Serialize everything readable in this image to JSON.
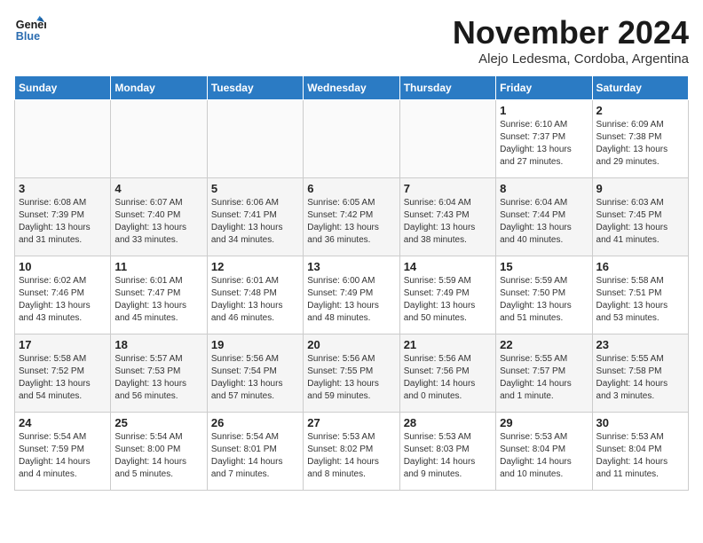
{
  "logo": {
    "line1": "General",
    "line2": "Blue"
  },
  "title": "November 2024",
  "subtitle": "Alejo Ledesma, Cordoba, Argentina",
  "days_of_week": [
    "Sunday",
    "Monday",
    "Tuesday",
    "Wednesday",
    "Thursday",
    "Friday",
    "Saturday"
  ],
  "weeks": [
    [
      {
        "day": "",
        "info": ""
      },
      {
        "day": "",
        "info": ""
      },
      {
        "day": "",
        "info": ""
      },
      {
        "day": "",
        "info": ""
      },
      {
        "day": "",
        "info": ""
      },
      {
        "day": "1",
        "info": "Sunrise: 6:10 AM\nSunset: 7:37 PM\nDaylight: 13 hours\nand 27 minutes."
      },
      {
        "day": "2",
        "info": "Sunrise: 6:09 AM\nSunset: 7:38 PM\nDaylight: 13 hours\nand 29 minutes."
      }
    ],
    [
      {
        "day": "3",
        "info": "Sunrise: 6:08 AM\nSunset: 7:39 PM\nDaylight: 13 hours\nand 31 minutes."
      },
      {
        "day": "4",
        "info": "Sunrise: 6:07 AM\nSunset: 7:40 PM\nDaylight: 13 hours\nand 33 minutes."
      },
      {
        "day": "5",
        "info": "Sunrise: 6:06 AM\nSunset: 7:41 PM\nDaylight: 13 hours\nand 34 minutes."
      },
      {
        "day": "6",
        "info": "Sunrise: 6:05 AM\nSunset: 7:42 PM\nDaylight: 13 hours\nand 36 minutes."
      },
      {
        "day": "7",
        "info": "Sunrise: 6:04 AM\nSunset: 7:43 PM\nDaylight: 13 hours\nand 38 minutes."
      },
      {
        "day": "8",
        "info": "Sunrise: 6:04 AM\nSunset: 7:44 PM\nDaylight: 13 hours\nand 40 minutes."
      },
      {
        "day": "9",
        "info": "Sunrise: 6:03 AM\nSunset: 7:45 PM\nDaylight: 13 hours\nand 41 minutes."
      }
    ],
    [
      {
        "day": "10",
        "info": "Sunrise: 6:02 AM\nSunset: 7:46 PM\nDaylight: 13 hours\nand 43 minutes."
      },
      {
        "day": "11",
        "info": "Sunrise: 6:01 AM\nSunset: 7:47 PM\nDaylight: 13 hours\nand 45 minutes."
      },
      {
        "day": "12",
        "info": "Sunrise: 6:01 AM\nSunset: 7:48 PM\nDaylight: 13 hours\nand 46 minutes."
      },
      {
        "day": "13",
        "info": "Sunrise: 6:00 AM\nSunset: 7:49 PM\nDaylight: 13 hours\nand 48 minutes."
      },
      {
        "day": "14",
        "info": "Sunrise: 5:59 AM\nSunset: 7:49 PM\nDaylight: 13 hours\nand 50 minutes."
      },
      {
        "day": "15",
        "info": "Sunrise: 5:59 AM\nSunset: 7:50 PM\nDaylight: 13 hours\nand 51 minutes."
      },
      {
        "day": "16",
        "info": "Sunrise: 5:58 AM\nSunset: 7:51 PM\nDaylight: 13 hours\nand 53 minutes."
      }
    ],
    [
      {
        "day": "17",
        "info": "Sunrise: 5:58 AM\nSunset: 7:52 PM\nDaylight: 13 hours\nand 54 minutes."
      },
      {
        "day": "18",
        "info": "Sunrise: 5:57 AM\nSunset: 7:53 PM\nDaylight: 13 hours\nand 56 minutes."
      },
      {
        "day": "19",
        "info": "Sunrise: 5:56 AM\nSunset: 7:54 PM\nDaylight: 13 hours\nand 57 minutes."
      },
      {
        "day": "20",
        "info": "Sunrise: 5:56 AM\nSunset: 7:55 PM\nDaylight: 13 hours\nand 59 minutes."
      },
      {
        "day": "21",
        "info": "Sunrise: 5:56 AM\nSunset: 7:56 PM\nDaylight: 14 hours\nand 0 minutes."
      },
      {
        "day": "22",
        "info": "Sunrise: 5:55 AM\nSunset: 7:57 PM\nDaylight: 14 hours\nand 1 minute."
      },
      {
        "day": "23",
        "info": "Sunrise: 5:55 AM\nSunset: 7:58 PM\nDaylight: 14 hours\nand 3 minutes."
      }
    ],
    [
      {
        "day": "24",
        "info": "Sunrise: 5:54 AM\nSunset: 7:59 PM\nDaylight: 14 hours\nand 4 minutes."
      },
      {
        "day": "25",
        "info": "Sunrise: 5:54 AM\nSunset: 8:00 PM\nDaylight: 14 hours\nand 5 minutes."
      },
      {
        "day": "26",
        "info": "Sunrise: 5:54 AM\nSunset: 8:01 PM\nDaylight: 14 hours\nand 7 minutes."
      },
      {
        "day": "27",
        "info": "Sunrise: 5:53 AM\nSunset: 8:02 PM\nDaylight: 14 hours\nand 8 minutes."
      },
      {
        "day": "28",
        "info": "Sunrise: 5:53 AM\nSunset: 8:03 PM\nDaylight: 14 hours\nand 9 minutes."
      },
      {
        "day": "29",
        "info": "Sunrise: 5:53 AM\nSunset: 8:04 PM\nDaylight: 14 hours\nand 10 minutes."
      },
      {
        "day": "30",
        "info": "Sunrise: 5:53 AM\nSunset: 8:04 PM\nDaylight: 14 hours\nand 11 minutes."
      }
    ]
  ]
}
